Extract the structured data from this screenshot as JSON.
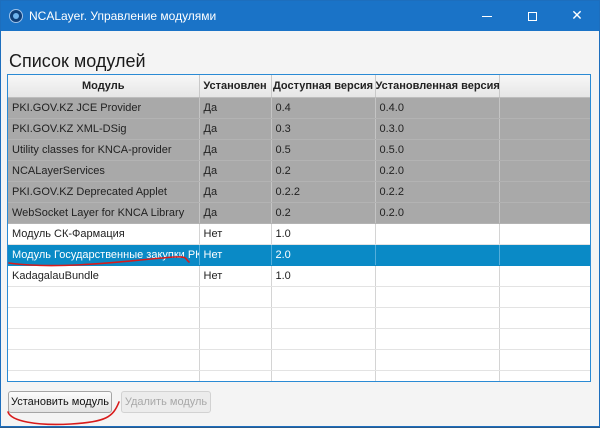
{
  "window": {
    "title": "NCALayer. Управление модулями",
    "controls": {
      "minimize": "",
      "maximize": "",
      "close": "✕"
    }
  },
  "section_title": "Список модулей",
  "table": {
    "columns": [
      "Модуль",
      "Установлен",
      "Доступная версия",
      "Установленная версия",
      ""
    ],
    "rows": [
      {
        "module": "PKI.GOV.KZ JCE Provider",
        "installed": "Да",
        "available": "0.4",
        "installed_version": "0.4.0",
        "state": "installed"
      },
      {
        "module": "PKI.GOV.KZ XML-DSig",
        "installed": "Да",
        "available": "0.3",
        "installed_version": "0.3.0",
        "state": "installed"
      },
      {
        "module": "Utility classes for KNCA-provider",
        "installed": "Да",
        "available": "0.5",
        "installed_version": "0.5.0",
        "state": "installed"
      },
      {
        "module": "NCALayerServices",
        "installed": "Да",
        "available": "0.2",
        "installed_version": "0.2.0",
        "state": "installed"
      },
      {
        "module": "PKI.GOV.KZ Deprecated Applet",
        "installed": "Да",
        "available": "0.2.2",
        "installed_version": "0.2.2",
        "state": "installed"
      },
      {
        "module": "WebSocket Layer for KNCA Library",
        "installed": "Да",
        "available": "0.2",
        "installed_version": "0.2.0",
        "state": "installed"
      },
      {
        "module": "Модуль СК-Фармация",
        "installed": "Нет",
        "available": "1.0",
        "installed_version": "",
        "state": "normal"
      },
      {
        "module": "Модуль Государственные закупки РК",
        "installed": "Нет",
        "available": "2.0",
        "installed_version": "",
        "state": "selected"
      },
      {
        "module": "KadagalauBundle",
        "installed": "Нет",
        "available": "1.0",
        "installed_version": "",
        "state": "normal"
      }
    ],
    "empty_rows": 5
  },
  "buttons": {
    "install": "Установить модуль",
    "remove": "Удалить модуль"
  },
  "colors": {
    "titlebar": "#1a73c7",
    "installed_row": "#a9a9a9",
    "selected_row": "#0a8ac6",
    "annotation": "#d81b1b"
  },
  "icons": {
    "app": "ncalayer-app-icon",
    "minimize": "minimize-icon",
    "maximize": "maximize-icon",
    "close": "close-icon"
  }
}
